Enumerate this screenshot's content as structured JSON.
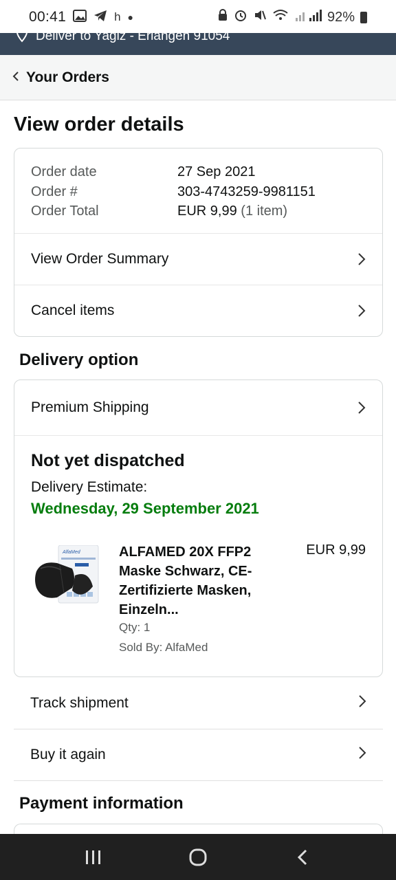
{
  "status": {
    "time": "00:41",
    "notif_letter": "h",
    "battery": "92%"
  },
  "deliver_bar": {
    "text": "Deliver to Yagiz - Erlangen 91054"
  },
  "breadcrumb": {
    "label": "Your Orders"
  },
  "page_title": "View order details",
  "order": {
    "date_label": "Order date",
    "date_value": "27 Sep 2021",
    "number_label": "Order #",
    "number_value": "303-4743259-9981151",
    "total_label": "Order Total",
    "total_value": "EUR 9,99",
    "total_count": "(1 item)",
    "view_summary": "View Order Summary",
    "cancel_items": "Cancel items"
  },
  "delivery": {
    "section_title": "Delivery option",
    "shipping_option": "Premium Shipping",
    "status": "Not yet dispatched",
    "estimate_label": "Delivery Estimate:",
    "estimate_date": "Wednesday, 29 September 2021",
    "accent_color": "#067d0e"
  },
  "item": {
    "title": "ALFAMED 20X FFP2 Maske Schwarz, CE-Zertifizierte Masken, Einzeln...",
    "price": "EUR 9,99",
    "qty": "Qty: 1",
    "sold_by": "Sold By: AlfaMed",
    "package_brand": "AlfaMed"
  },
  "actions": {
    "track": "Track shipment",
    "buy_again": "Buy it again"
  },
  "payment": {
    "section_title": "Payment information"
  }
}
